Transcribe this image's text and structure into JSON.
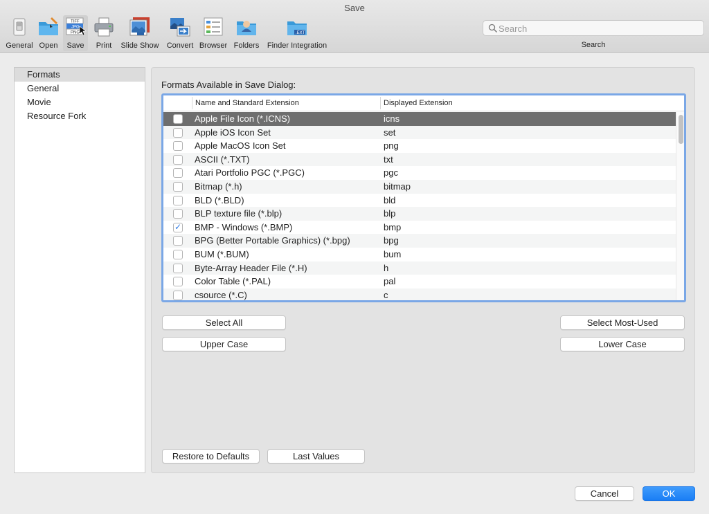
{
  "window": {
    "title": "Save"
  },
  "toolbar": {
    "items": [
      {
        "label": "General",
        "icon": "general-switch-icon"
      },
      {
        "label": "Open",
        "icon": "open-folder-brush-icon"
      },
      {
        "label": "Save",
        "icon": "save-formats-icon",
        "active": true
      },
      {
        "label": "Print",
        "icon": "printer-icon"
      },
      {
        "label": "Slide Show",
        "icon": "slideshow-icon"
      },
      {
        "label": "Convert",
        "icon": "convert-icon"
      },
      {
        "label": "Browser",
        "icon": "browser-icon"
      },
      {
        "label": "Folders",
        "icon": "folders-icon"
      },
      {
        "label": "Finder Integration",
        "icon": "finder-integration-icon"
      }
    ],
    "search": {
      "placeholder": "Search",
      "label": "Search"
    }
  },
  "sidebar": {
    "items": [
      {
        "label": "Formats",
        "selected": true
      },
      {
        "label": "General"
      },
      {
        "label": "Movie"
      },
      {
        "label": "Resource Fork"
      }
    ]
  },
  "main": {
    "heading": "Formats Available in Save Dialog:",
    "table": {
      "columns": [
        "Name and Standard Extension",
        "Displayed Extension"
      ],
      "rows": [
        {
          "name": "Apple File Icon (*.ICNS)",
          "ext": "icns",
          "checked": false,
          "selected": true
        },
        {
          "name": "Apple iOS Icon Set",
          "ext": "set",
          "checked": false
        },
        {
          "name": "Apple MacOS Icon Set",
          "ext": "png",
          "checked": false
        },
        {
          "name": "ASCII (*.TXT)",
          "ext": "txt",
          "checked": false
        },
        {
          "name": "Atari Portfolio PGC (*.PGC)",
          "ext": "pgc",
          "checked": false
        },
        {
          "name": "Bitmap (*.h)",
          "ext": "bitmap",
          "checked": false
        },
        {
          "name": "BLD (*.BLD)",
          "ext": "bld",
          "checked": false
        },
        {
          "name": "BLP texture file (*.blp)",
          "ext": "blp",
          "checked": false
        },
        {
          "name": "BMP - Windows (*.BMP)",
          "ext": "bmp",
          "checked": true
        },
        {
          "name": "BPG (Better Portable Graphics) (*.bpg)",
          "ext": "bpg",
          "checked": false
        },
        {
          "name": "BUM (*.BUM)",
          "ext": "bum",
          "checked": false
        },
        {
          "name": "Byte-Array Header File (*.H)",
          "ext": "h",
          "checked": false
        },
        {
          "name": "Color Table (*.PAL)",
          "ext": "pal",
          "checked": false
        },
        {
          "name": "csource (*.C)",
          "ext": "c",
          "checked": false
        }
      ]
    },
    "buttons": {
      "select_all": "Select All",
      "select_most_used": "Select Most-Used",
      "upper_case": "Upper Case",
      "lower_case": "Lower Case",
      "restore_defaults": "Restore to Defaults",
      "last_values": "Last Values"
    }
  },
  "footer": {
    "cancel": "Cancel",
    "ok": "OK"
  },
  "colors": {
    "accent": "#1a7ef5",
    "selection_row": "#6e6e6e",
    "focus_ring": "#7aa7e6"
  }
}
